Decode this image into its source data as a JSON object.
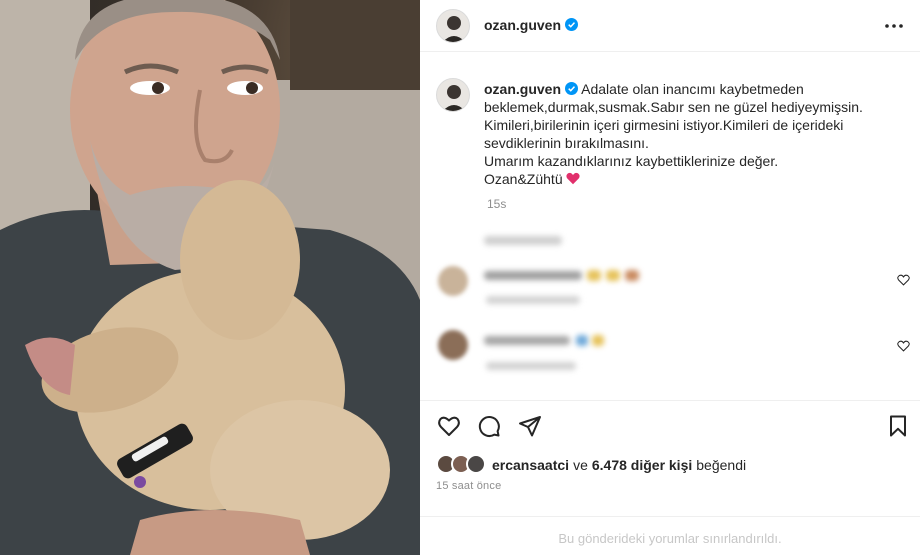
{
  "post": {
    "username": "ozan.guven",
    "verified": true,
    "caption_lines": [
      "Adalate olan inancımı kaybetmeden",
      "beklemek,durmak,susmak.Sabır sen ne güzel hediyeymişsin.",
      "Kimileri,birilerinin içeri girmesini istiyor.Kimileri de içerideki",
      "sevdiklerinin bırakılmasını.",
      "Umarım kazandıklarınız kaybettiklerinize değer.",
      "Ozan&Zühtü"
    ],
    "caption_time": "15s"
  },
  "likes": {
    "liker": "ercansaatci",
    "conj": "ve",
    "others": "6.478 diğer kişi",
    "suffix": "beğendi"
  },
  "post_time": "15 saat önce",
  "footer_text": "Bu gönderideki yorumlar sınırlandırıldı.",
  "icons": {
    "header": [
      "verified-badge-icon",
      "more-options-icon"
    ],
    "actions": [
      "like-icon",
      "comment-icon",
      "share-icon",
      "save-icon"
    ],
    "comment": [
      "comment-like-icon"
    ]
  },
  "colors": {
    "verified": "#0095f6",
    "heart_emoji": "#e1306c",
    "text": "#262626",
    "secondary": "#8e8e8e"
  }
}
